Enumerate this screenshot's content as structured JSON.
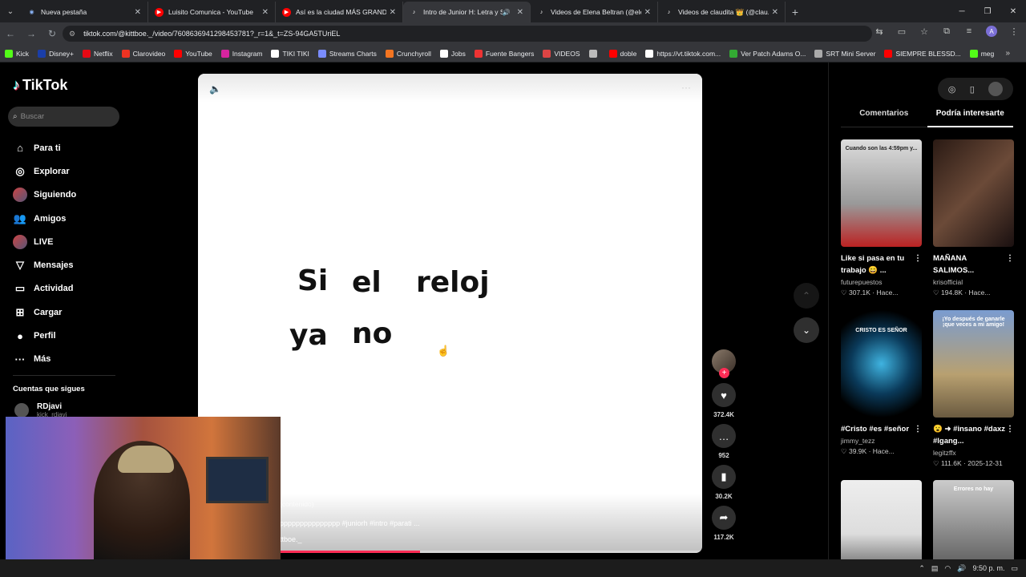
{
  "browser": {
    "tabs": [
      {
        "title": "Nueva pestaña",
        "icon": "chrome-icon",
        "color": "#8ab4f8"
      },
      {
        "title": "Luisito Comunica - YouTube",
        "icon": "youtube-icon",
        "color": "#ff0000"
      },
      {
        "title": "Así es la ciudad MÁS GRANDE",
        "icon": "youtube-icon",
        "color": "#ff0000"
      },
      {
        "title": "Intro de Junior H: Letra y Si",
        "icon": "tiktok-icon",
        "color": "#ffffff",
        "active": true
      },
      {
        "title": "Videos de Elena Beltran (@eler",
        "icon": "tiktok-icon",
        "color": "#ffffff"
      },
      {
        "title": "Videos de claudita 👑 (@clau.",
        "icon": "tiktok-icon",
        "color": "#ffffff"
      }
    ],
    "url": "tiktok.com/@kittboe._/video/7608636941298453781?_r=1&_t=ZS-94GA5TUriEL",
    "bookmarks": [
      {
        "label": "Kick",
        "color": "#53fc18"
      },
      {
        "label": "Disney+",
        "color": "#1a3ea8"
      },
      {
        "label": "Netflix",
        "color": "#e50914"
      },
      {
        "label": "Clarovideo",
        "color": "#e32"
      },
      {
        "label": "YouTube",
        "color": "#ff0000"
      },
      {
        "label": "Instagram",
        "color": "#d6249f"
      },
      {
        "label": "TIKI TIKI",
        "color": "#fff"
      },
      {
        "label": "Streams Charts",
        "color": "#7a8cff"
      },
      {
        "label": "Crunchyroll",
        "color": "#f47521"
      },
      {
        "label": "Jobs",
        "color": "#fff"
      },
      {
        "label": "Fuente Bangers",
        "color": "#e33"
      },
      {
        "label": "VIDEOS",
        "color": "#d44"
      },
      {
        "label": "",
        "color": "#bbb"
      },
      {
        "label": "doble",
        "color": "#ff0000"
      },
      {
        "label": "https://vt.tiktok.com...",
        "color": "#fff"
      },
      {
        "label": "Ver Patch Adams O...",
        "color": "#3a3"
      },
      {
        "label": "SRT Mini Server",
        "color": "#aaa"
      },
      {
        "label": "SIEMPRE BLESSD...",
        "color": "#ff0000"
      },
      {
        "label": "meg",
        "color": "#53fc18"
      }
    ]
  },
  "sidebar": {
    "logo": "TikTok",
    "search_placeholder": "Buscar",
    "items": [
      {
        "label": "Para ti",
        "icon": "home-icon",
        "glyph": "⌂"
      },
      {
        "label": "Explorar",
        "icon": "compass-icon",
        "glyph": "◎"
      },
      {
        "label": "Siguiendo",
        "icon": "following-avatar-icon",
        "glyph": ""
      },
      {
        "label": "Amigos",
        "icon": "friends-icon",
        "glyph": "👥"
      },
      {
        "label": "LIVE",
        "icon": "live-avatar-icon",
        "glyph": ""
      },
      {
        "label": "Mensajes",
        "icon": "message-icon",
        "glyph": "▽"
      },
      {
        "label": "Actividad",
        "icon": "activity-icon",
        "glyph": "▭"
      },
      {
        "label": "Cargar",
        "icon": "upload-icon",
        "glyph": "⊞"
      },
      {
        "label": "Perfil",
        "icon": "profile-icon",
        "glyph": "●"
      },
      {
        "label": "Más",
        "icon": "more-icon",
        "glyph": "···"
      }
    ],
    "following_header": "Cuentas que sigues",
    "following_user": {
      "name": "RDjavi",
      "handle": "kick_rdjavi"
    }
  },
  "video": {
    "lyrics": [
      "Si",
      "el",
      "reloj",
      "ya",
      "no"
    ],
    "desc_line1": "(contenido)",
    "desc_line2": "ppppppppppppppp #juniorh #intro #parati ...",
    "desc_line3": "ttboe._",
    "progress": 0.44
  },
  "actions": {
    "likes": "372.4K",
    "comments": "952",
    "saves": "30.2K",
    "shares": "117.2K"
  },
  "right_panel": {
    "tabs": [
      "Comentarios",
      "Podría interesarte"
    ],
    "active_tab": 1,
    "cards": [
      {
        "title": "Like si pasa en tu trabajo 😄 ...",
        "user": "futurepuestos",
        "likes": "307.1K",
        "time": "Hace...",
        "thumb_text": "Cuando son las 4:59pm y...",
        "bg": "linear-gradient(#ddd,#999 60%,#b22 100%)"
      },
      {
        "title": "MAÑANA SALIMOS...",
        "user": "krisofficial",
        "likes": "194.8K",
        "time": "Hace...",
        "thumb_text": "",
        "bg": "linear-gradient(135deg,#2a1a14,#6b4a38 50%,#1a1010)"
      },
      {
        "title": "#Cristo #es #señor",
        "user": "jimmy_tezz",
        "likes": "39.9K",
        "time": "Hace...",
        "thumb_text": "CRISTO ES SEÑOR",
        "bg": "radial-gradient(circle at 50% 50%,#3fb3e0 0%,#0a3a5a 45%,#000 80%)"
      },
      {
        "title": "😮 ➜ #insano #daxz #lgang...",
        "user": "legitzffx",
        "likes": "111.6K",
        "time": "2025-12-31",
        "thumb_text": "¡Yo después de ganarle ¡que veces a mi amigo!",
        "bg": "linear-gradient(#7a9cd0,#b8a070 60%,#6a5a40)"
      },
      {
        "title": "",
        "user": "",
        "likes": "",
        "time": "",
        "thumb_text": "",
        "bg": "linear-gradient(#eee,#ddd 50%,#333)"
      },
      {
        "title": "",
        "user": "",
        "likes": "",
        "time": "",
        "thumb_text": "Errores no hay",
        "bg": "linear-gradient(#ccc,#444)"
      }
    ]
  },
  "taskbar": {
    "time": "9:50 p. m."
  }
}
